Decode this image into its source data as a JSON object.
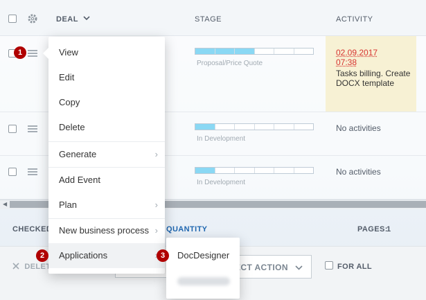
{
  "header": {
    "deal_label": "DEAL",
    "stage_label": "STAGE",
    "activity_label": "ACTIVITY"
  },
  "rows": [
    {
      "stage_label": "Proposal/Price Quote",
      "stage_filled_segments": 3,
      "stage_total_segments": 6,
      "activity_date": "02.09.2017 07:38",
      "activity_text": "Tasks billing. Create DOCX template"
    },
    {
      "stage_label": "In Development",
      "stage_filled_segments": 1,
      "stage_total_segments": 6,
      "activity_text": "No activities"
    },
    {
      "stage_label": "In Development",
      "stage_filled_segments": 1,
      "stage_total_segments": 6,
      "activity_text": "No activities"
    }
  ],
  "context_menu": {
    "items": [
      {
        "label": "View"
      },
      {
        "label": "Edit"
      },
      {
        "label": "Copy"
      },
      {
        "label": "Delete"
      },
      {
        "label": "Generate"
      },
      {
        "label": "Add Event"
      },
      {
        "label": "Plan"
      },
      {
        "label": "New business process"
      },
      {
        "label": "Applications"
      }
    ],
    "submenu_chevron": "›"
  },
  "submenu": {
    "items": [
      {
        "label": "DocDesigner"
      }
    ]
  },
  "badges": [
    "1",
    "2",
    "3"
  ],
  "footer": {
    "checked_label": "CHECKED:",
    "quantity_label": "QUANTITY",
    "pages_label": "PAGES:",
    "pages_value": "1"
  },
  "actionbar": {
    "delete_label": "DELET",
    "select_action_label": "ECT ACTION",
    "for_all_label": "FOR ALL"
  },
  "colors": {
    "badge": "#b00000",
    "stage_fill": "#8ad8f4",
    "activity_bg": "#f7f1d4",
    "date_red": "#d7332f",
    "link_blue": "#2067b0"
  },
  "icons": {
    "settings": "gear-icon",
    "row_menu": "burger-icon",
    "dropdown": "chevron-down-icon",
    "submenu": "chevron-right-icon",
    "delete": "close-icon"
  }
}
